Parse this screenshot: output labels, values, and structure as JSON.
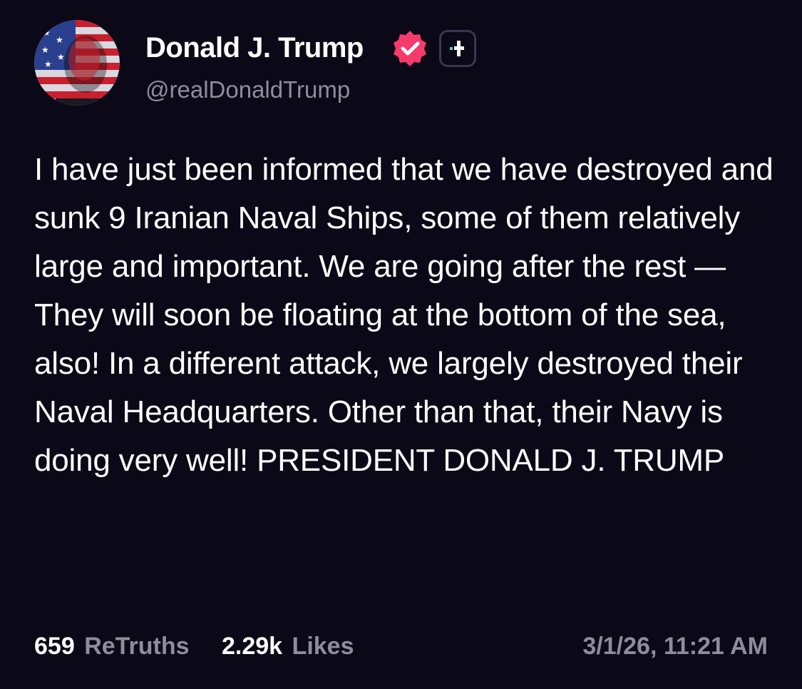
{
  "author": {
    "display_name": "Donald J. Trump",
    "handle": "@realDonaldTrump",
    "avatar_icon": "flag-portrait-avatar",
    "verified_icon": "verified-badge-icon",
    "plus_icon": "truth-plus-icon"
  },
  "post": {
    "text": "I have just been informed that we have destroyed and sunk 9 Iranian Naval Ships, some of them relatively large and important. We are going after the rest — They will soon be floating at the bottom of the sea, also! In a different attack, we largely destroyed their Naval Headquarters. Other than that, their Navy is doing very well! PRESIDENT DONALD J. TRUMP"
  },
  "stats": {
    "retruths_count": "659",
    "retruths_label": "ReTruths",
    "likes_count": "2.29k",
    "likes_label": "Likes"
  },
  "timestamp": "3/1/26, 11:21 AM",
  "colors": {
    "background": "#0b0817",
    "primary_text": "#ffffff",
    "secondary_text": "#8f8c9e",
    "verified_pink": "#f53b6b",
    "plus_teal": "#3ee0c8"
  }
}
